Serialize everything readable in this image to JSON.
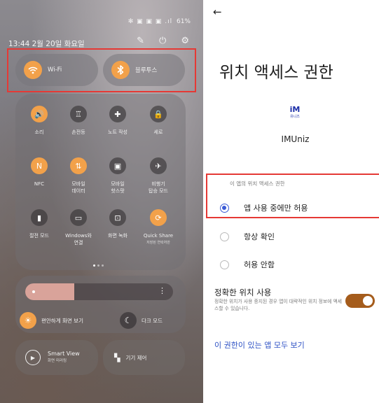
{
  "left_panel": {
    "status": {
      "icons": "✻ ▣ ▣ ▣ .ıl",
      "battery": "61%"
    },
    "datetime": "13:44  2월 20일 화요일",
    "top_icons": {
      "edit": "pencil-icon",
      "power": "power-icon",
      "settings": "gear-icon"
    },
    "wide_tiles": {
      "wifi_label": "Wi-Fi",
      "bluetooth_label": "블루투스"
    },
    "quick_tiles": [
      {
        "label": "소리",
        "sub": "",
        "state": "on",
        "glyph": "🔊"
      },
      {
        "label": "손전등",
        "sub": "",
        "state": "off",
        "glyph": "♖"
      },
      {
        "label": "노트 작성",
        "sub": "",
        "state": "off",
        "glyph": "✚"
      },
      {
        "label": "세로",
        "sub": "",
        "state": "off",
        "glyph": "🔒"
      },
      {
        "label": "NFC",
        "sub": "",
        "state": "on",
        "glyph": "N"
      },
      {
        "label": "모바일\n데이터",
        "sub": "",
        "state": "on",
        "glyph": "⇅"
      },
      {
        "label": "모바일\n핫스팟",
        "sub": "",
        "state": "off",
        "glyph": "▣"
      },
      {
        "label": "비행기\n탑승 모드",
        "sub": "",
        "state": "off",
        "glyph": "✈"
      },
      {
        "label": "절전 모드",
        "sub": "",
        "state": "off",
        "glyph": "▮"
      },
      {
        "label": "Windows와\n연결",
        "sub": "",
        "state": "off",
        "glyph": "▭"
      },
      {
        "label": "화면 녹화",
        "sub": "",
        "state": "off",
        "glyph": "⊡"
      },
      {
        "label": "Quick Share",
        "sub": "저장된 연락처만",
        "state": "on",
        "glyph": "⟳"
      }
    ],
    "brightness": {
      "level": 0.33
    },
    "eye_comfort_label": "편안하게 화면 보기",
    "dark_mode_label": "다크 모드",
    "smart_view": {
      "title": "Smart View",
      "sub": "화면 미러링"
    },
    "device_control_label": "기기 제어",
    "accent_color": "#f2a14a"
  },
  "right_panel": {
    "title": "위치 액세스 권한",
    "app": {
      "logo_text": "iM",
      "logo_sub": "유니즈",
      "name": "IMUniz"
    },
    "section_header": "이 앱의 위치 액세스 권한",
    "options": [
      {
        "label": "앱 사용 중에만 허용",
        "checked": true
      },
      {
        "label": "항상 확인",
        "checked": false
      },
      {
        "label": "허용 안함",
        "checked": false
      }
    ],
    "precise": {
      "title": "정확한 위치 사용",
      "desc": "정확한 위치가 사용 중지된 경우 앱이 대략적인 위치 정보에 액세스할 수 있습니다.",
      "enabled": true
    },
    "see_all_link": "이 권한이 있는 앱 모두 보기",
    "accent_color": "#3a5bd6",
    "toggle_color": "#a55c1c"
  }
}
